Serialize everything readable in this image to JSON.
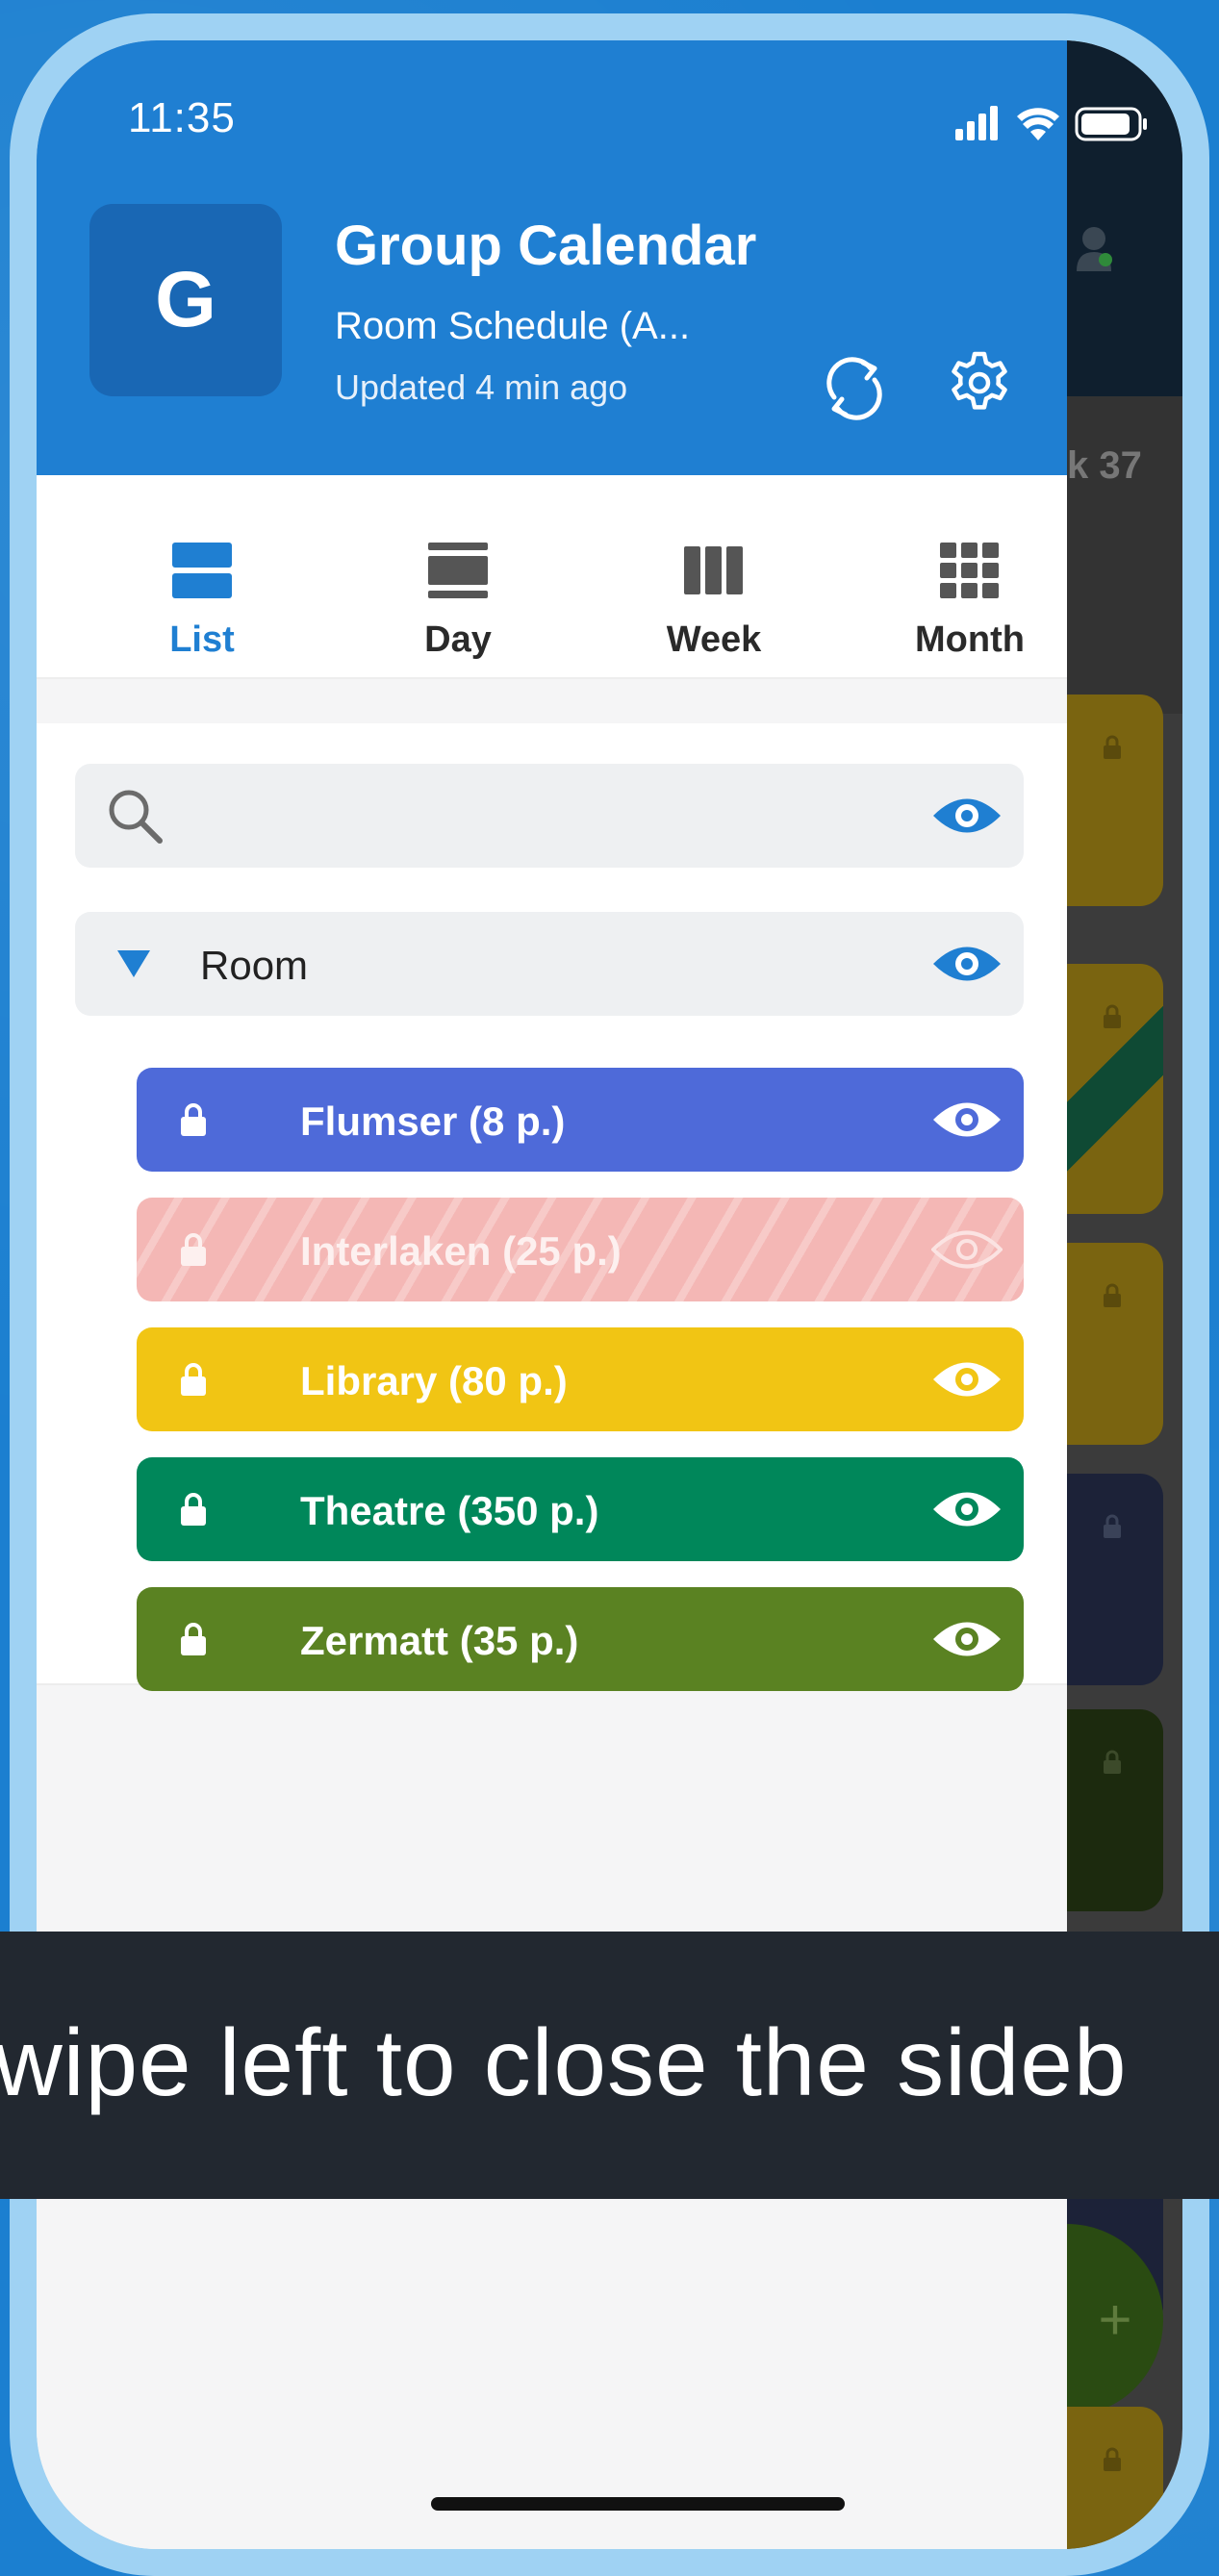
{
  "status_bar": {
    "time": "11:35"
  },
  "header": {
    "avatar_letter": "G",
    "title": "Group Calendar",
    "subtitle": "Room Schedule (A...",
    "updated": "Updated 4 min ago"
  },
  "tabs": [
    {
      "label": "List",
      "icon": "list-icon",
      "active": true
    },
    {
      "label": "Day",
      "icon": "day-icon",
      "active": false
    },
    {
      "label": "Week",
      "icon": "week-icon",
      "active": false
    },
    {
      "label": "Month",
      "icon": "month-icon",
      "active": false
    }
  ],
  "search": {
    "placeholder": ""
  },
  "group": {
    "label": "Room",
    "expanded": true
  },
  "rooms": [
    {
      "label": "Flumser (8 p.)",
      "color": "#4e6ad9",
      "visible": true
    },
    {
      "label": "Interlaken (25 p.)",
      "color": "#f4b7b5",
      "visible": false
    },
    {
      "label": "Library (80 p.)",
      "color": "#f1c514",
      "visible": true
    },
    {
      "label": "Theatre (350 p.)",
      "color": "#00875a",
      "visible": true
    },
    {
      "label": "Zermatt (35 p.)",
      "color": "#5a8222",
      "visible": true
    }
  ],
  "background_app": {
    "week_label": "k 37"
  },
  "toast": {
    "text": "wipe left to close the sideb"
  },
  "colors": {
    "accent": "#1f7fd2",
    "header_bg": "#1f7fd2"
  }
}
